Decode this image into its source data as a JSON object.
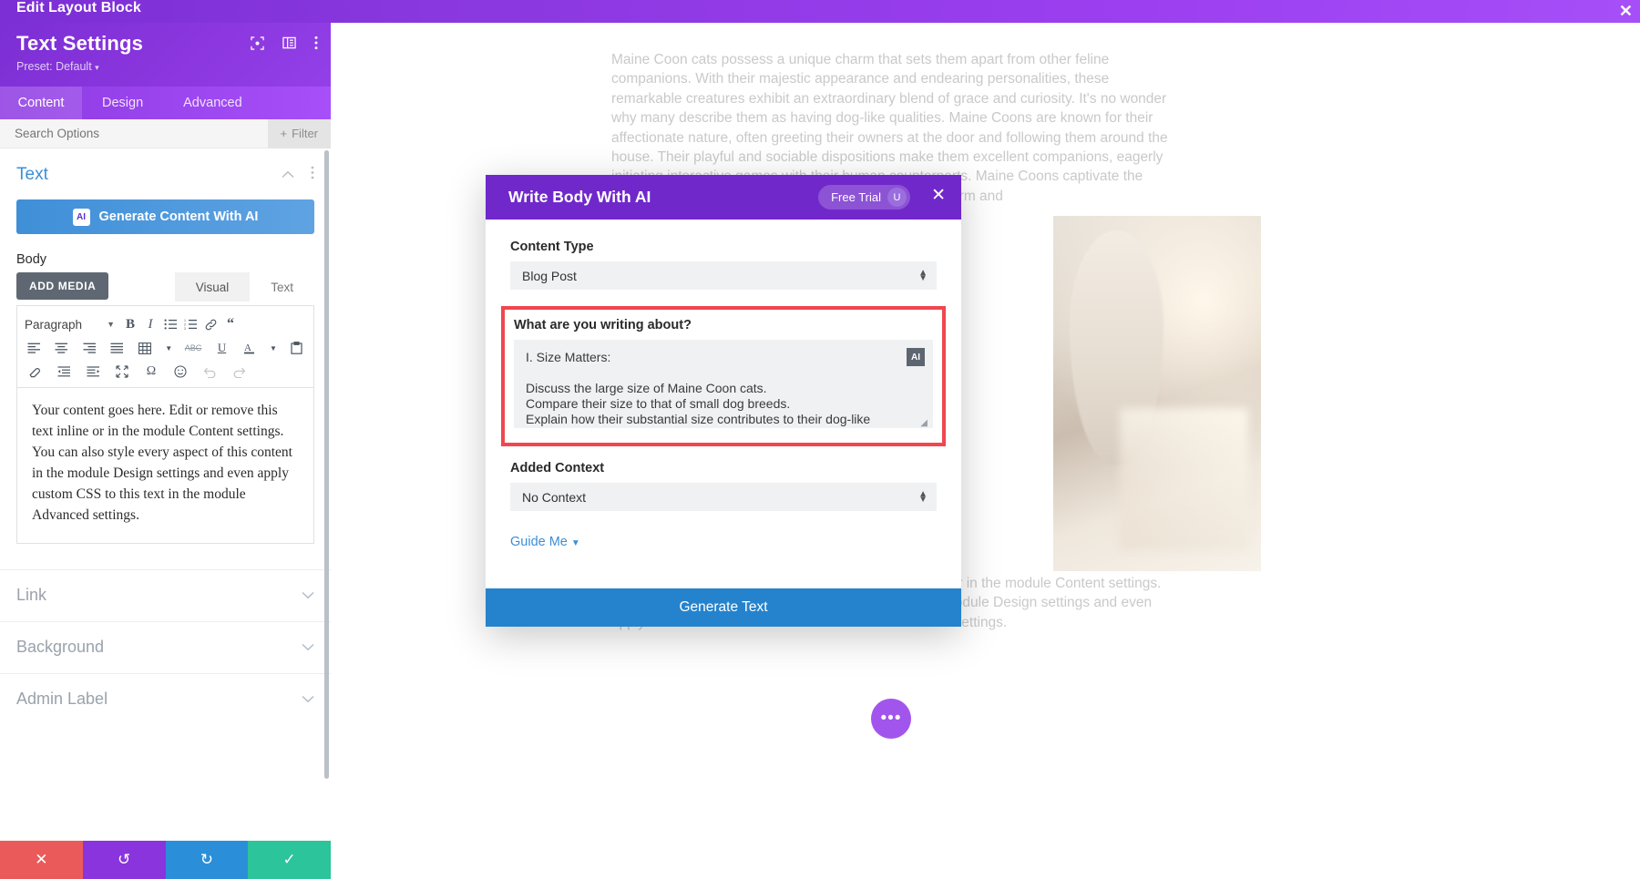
{
  "topbar": {
    "title": "Edit Layout Block",
    "close_icon": "close-icon"
  },
  "sidebar": {
    "title": "Text Settings",
    "preset": "Preset: Default",
    "preset_caret": "▾",
    "head_icons": [
      "target-icon",
      "layout-columns-icon",
      "more-vertical-icon"
    ],
    "tabs": [
      {
        "label": "Content",
        "active": true
      },
      {
        "label": "Design",
        "active": false
      },
      {
        "label": "Advanced",
        "active": false
      }
    ],
    "search": {
      "placeholder": "Search Options",
      "value": ""
    },
    "filter_label": "Filter",
    "filter_icon": "plus-icon",
    "section_text": {
      "title": "Text",
      "collapse_icon": "chevron-up-icon",
      "more_icon": "more-vertical-icon"
    },
    "ai_button": {
      "label": "Generate Content With AI",
      "chip": "AI"
    },
    "body_label": "Body",
    "add_media_label": "ADD MEDIA",
    "editor_tabs": [
      {
        "label": "Visual",
        "active": true
      },
      {
        "label": "Text",
        "active": false
      }
    ],
    "toolbar": {
      "paragraph_label": "Paragraph",
      "row1": [
        "bold-icon",
        "italic-icon",
        "bulleted-list-icon",
        "numbered-list-icon",
        "link-icon",
        "blockquote-icon"
      ],
      "row2": [
        "align-left-icon",
        "align-center-icon",
        "align-right-icon",
        "align-justify-icon",
        "table-icon",
        "strikethrough-icon",
        "underline-icon",
        "text-color-icon",
        "paste-icon"
      ],
      "row3": [
        "clear-formatting-icon",
        "decrease-indent-icon",
        "increase-indent-icon",
        "fullscreen-icon",
        "special-character-icon",
        "emoji-icon",
        "undo-icon",
        "redo-icon"
      ]
    },
    "editor_content": "Your content goes here. Edit or remove this text inline or in the module Content settings. You can also style every aspect of this content in the module Design settings and even apply custom CSS to this text in the module Advanced settings.",
    "sections": [
      {
        "label": "Link",
        "chevron": "chevron-down-icon"
      },
      {
        "label": "Background",
        "chevron": "chevron-down-icon"
      },
      {
        "label": "Admin Label",
        "chevron": "chevron-down-icon"
      }
    ],
    "actions": [
      {
        "name": "cancel",
        "icon": "✕",
        "color": "#eb5a5a"
      },
      {
        "name": "undo",
        "icon": "↺",
        "color": "#8a34dd"
      },
      {
        "name": "redo",
        "icon": "↻",
        "color": "#2a8fd8"
      },
      {
        "name": "save",
        "icon": "✓",
        "color": "#2cc49a"
      }
    ]
  },
  "canvas": {
    "paragraph_1": "Maine Coon cats possess a unique charm that sets them apart from other feline companions. With their majestic appearance and endearing personalities, these remarkable creatures exhibit an extraordinary blend of grace and curiosity. It's no wonder why many describe them as having dog-like qualities. Maine Coons are known for their affectionate nature, often greeting their owners at the door and following them around the house. Their playful and sociable dispositions make them excellent companions, eagerly initiating interactive games with their human counterparts. Maine Coons captivate the hearts of cat and dog lovers alike with their dog-like charm and",
    "paragraph_2": "Your content goes here. Edit or remove this text inline or in the module Content settings. You can also style every aspect of this content in the module Design settings and even apply custom CSS to this text in the module Advanced settings.",
    "fab_icon": "ellipsis-icon"
  },
  "modal": {
    "title": "Write Body With AI",
    "free_trial_label": "Free Trial",
    "avatar_initial": "U",
    "close_icon": "close-icon",
    "content_type": {
      "label": "Content Type",
      "value": "Blog Post"
    },
    "prompt": {
      "label": "What are you writing about?",
      "value": "I. Size Matters:\n\nDiscuss the large size of Maine Coon cats.\nCompare their size to that of small dog breeds.\nExplain how their substantial size contributes to their dog-like\nappearance.",
      "ai_chip": "AI"
    },
    "added_context": {
      "label": "Added Context",
      "value": "No Context"
    },
    "guide_me": {
      "label": "Guide Me",
      "caret": "▼"
    },
    "generate_button": "Generate Text",
    "highlight_color": "#f0474f"
  }
}
